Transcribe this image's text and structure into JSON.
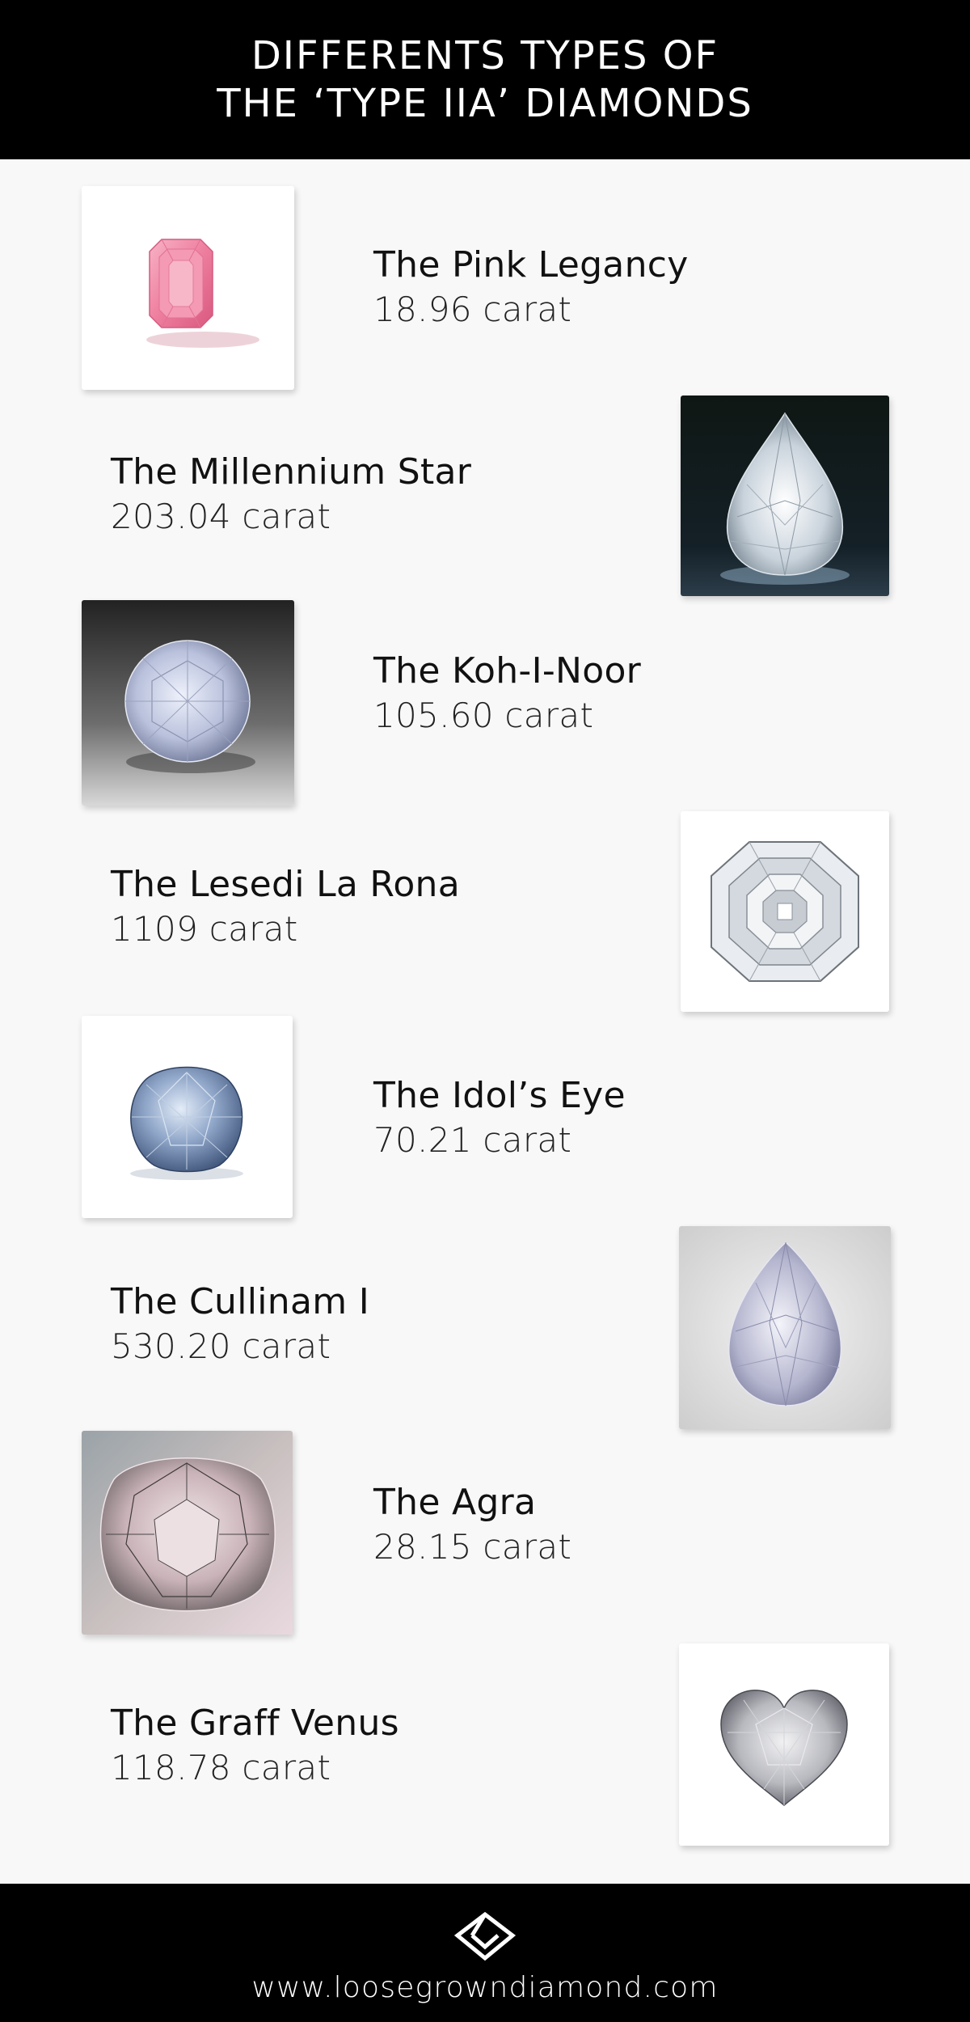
{
  "header": {
    "title_line1": "DIFFERENTS TYPES OF",
    "title_line2": "THE ‘TYPE IIA’ DIAMONDS"
  },
  "diamonds": [
    {
      "name": "The Pink Legancy",
      "weight": "18.96 carat",
      "image": "pink-emerald-cut-diamond"
    },
    {
      "name": "The Millennium Star",
      "weight": "203.04 carat",
      "image": "pear-diamond-dark-background"
    },
    {
      "name": "The Koh-I-Noor",
      "weight": "105.60 carat",
      "image": "oval-diamond-gray-background"
    },
    {
      "name": "The Lesedi La Rona",
      "weight": "1109 carat",
      "image": "square-emerald-cut-diamond"
    },
    {
      "name": "The Idol’s Eye",
      "weight": "70.21 carat",
      "image": "cushion-blue-diamond"
    },
    {
      "name": "The Cullinam I",
      "weight": "530.20 carat",
      "image": "pear-diamond-light-background"
    },
    {
      "name": "The Agra",
      "weight": "28.15 carat",
      "image": "pink-cushion-diamond-closeup"
    },
    {
      "name": "The Graff Venus",
      "weight": "118.78 carat",
      "image": "heart-shaped-diamond"
    }
  ],
  "footer": {
    "logo": "diamond-logo-icon",
    "url": "www.loosegrowndiamond.com"
  },
  "colors": {
    "header_bg": "#000000",
    "page_bg": "#f8f8f8",
    "text": "#111111",
    "pink_diamond": "#f08aa8"
  }
}
